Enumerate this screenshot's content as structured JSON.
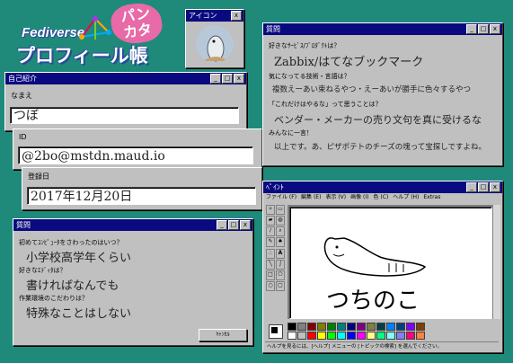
{
  "logo": {
    "line1": "Fediverse",
    "line2": "プロフィール帳",
    "badge": "パンカタ"
  },
  "icon_window": {
    "title": "アイコン",
    "close": "x"
  },
  "intro_window": {
    "title": "自己紹介",
    "name_label": "なまえ",
    "name_value": "つぼ",
    "min": "_",
    "max": "□",
    "close": "x"
  },
  "id_window": {
    "label": "ID",
    "value": "@2bo@mstdn.maud.io"
  },
  "reg_window": {
    "label": "登録日",
    "value": "2017年12月20日"
  },
  "questions_window": {
    "title": "質問",
    "items": [
      {
        "q": "好きなｻｰﾋﾞｽ/ﾌﾞﾛﾀﾞｸﾄは？",
        "a": "Zabbix/はてなブックマーク"
      },
      {
        "q": "気になってる技術・言語は？",
        "a": "複数えーあい束ねるやつ・えーあいが勝手に色々するやつ"
      },
      {
        "q": "「これだけはやるな」って思うことは？",
        "a": "ベンダー・メーカーの売り文句を真に受けるな"
      },
      {
        "q": "みんなに一言！",
        "a": "以上です。あ、ピザポテトのチーズの塊って宝探しですよね。"
      }
    ]
  },
  "qa_window": {
    "title": "質問",
    "items": [
      {
        "q": "初めてｺﾝﾋﾟｭｰﾀをさわったのはいつ？",
        "a": "小学校高学年くらい"
      },
      {
        "q": "好きなｴﾃﾞｨﾀは？",
        "a": "書ければなんでも"
      },
      {
        "q": "作業環境のこだわりは？",
        "a": "特殊なことはしない"
      }
    ],
    "cancel": "ｷｬﾝｾﾙ"
  },
  "paint_window": {
    "title": "ﾍﾟｲﾝﾄ",
    "menu": [
      "ファイル (F)",
      "編集 (E)",
      "表示 (V)",
      "画像 (I)",
      "色 (C)",
      "ヘルプ (H)",
      "Extras"
    ],
    "status": "ヘルプを見るには、[ヘルプ] メニューの [トピックの検索] を選んでください。",
    "drawing_text": "つちのこ",
    "palette": [
      "#000000",
      "#808080",
      "#800000",
      "#808000",
      "#008000",
      "#008080",
      "#000080",
      "#800080",
      "#808040",
      "#004040",
      "#0080ff",
      "#004080",
      "#8000ff",
      "#804000",
      "#ffffff",
      "#c0c0c0",
      "#ff0000",
      "#ffff00",
      "#00ff00",
      "#00ffff",
      "#0000ff",
      "#ff00ff",
      "#ffff80",
      "#00ff80",
      "#80ffff",
      "#8080ff",
      "#ff0080",
      "#ff8040"
    ]
  }
}
